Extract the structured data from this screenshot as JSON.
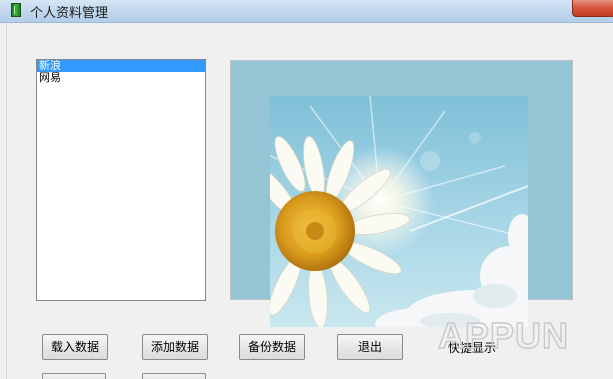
{
  "window": {
    "title": "个人资料管理"
  },
  "listbox": {
    "items": [
      {
        "label": "新浪",
        "selected": true
      },
      {
        "label": "网易",
        "selected": false
      }
    ]
  },
  "buttons": {
    "load": "载入数据",
    "add": "添加数据",
    "backup": "备份数据",
    "exit": "退出"
  },
  "quick_show_label": "快捷显示",
  "watermark": {
    "text": "APPUN"
  },
  "colors": {
    "selection": "#3399ff",
    "photo_background": "#95c5d5"
  },
  "icons": {
    "app_icon": "green-book-icon",
    "close": "close-icon"
  }
}
